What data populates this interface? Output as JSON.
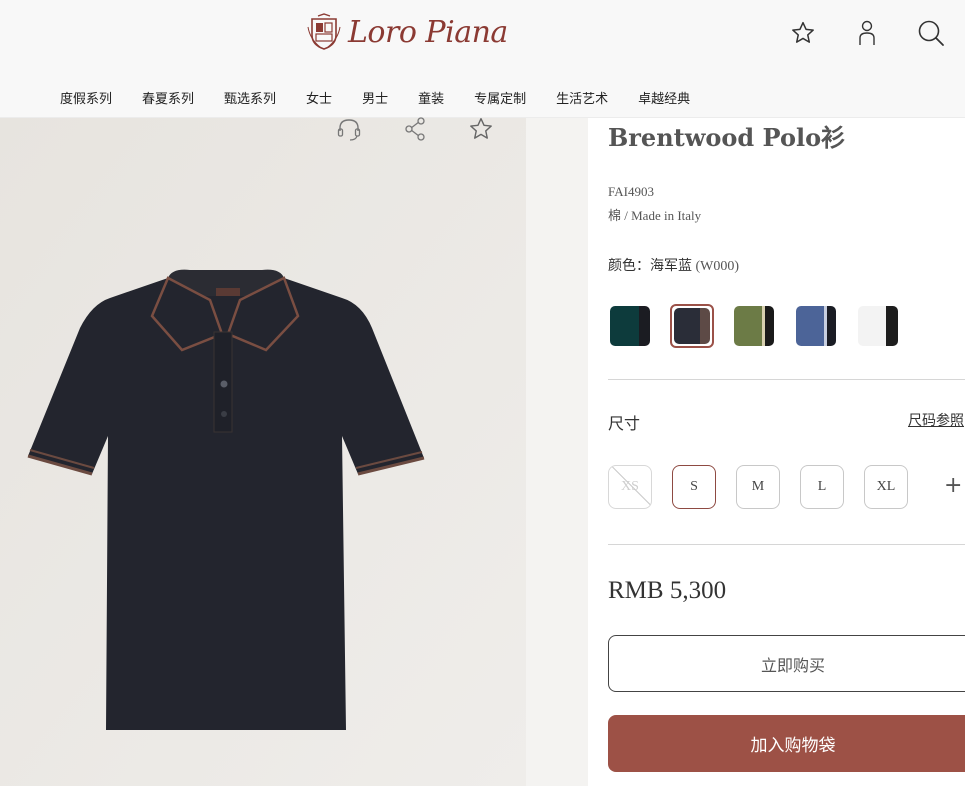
{
  "header": {
    "logo_text": "Loro Piana",
    "icons": [
      "star-icon",
      "account-icon",
      "search-icon"
    ],
    "nav": [
      {
        "label": "度假系列"
      },
      {
        "label": "春夏系列"
      },
      {
        "label": "甄选系列"
      },
      {
        "label": "女士"
      },
      {
        "label": "男士"
      },
      {
        "label": "童装"
      },
      {
        "label": "专属定制"
      },
      {
        "label": "生活艺术"
      },
      {
        "label": "卓越经典"
      }
    ]
  },
  "image_tools": [
    "headset-icon",
    "share-icon",
    "star-icon"
  ],
  "product": {
    "title": "Brentwood Polo衫",
    "sku": "FAI4903",
    "material": "棉 / Made in Italy",
    "color_label": "颜色：海军蓝",
    "color_code": " (W000)",
    "swatches": [
      {
        "name": "dark-green",
        "left": "#0b3a3a",
        "right": "#1b1c20",
        "selected": false
      },
      {
        "name": "navy",
        "left": "#2a2d38",
        "right": "#5a4744",
        "selected": true
      },
      {
        "name": "olive",
        "left": "#6b7a44",
        "right": "#1a1a1a",
        "selected": false
      },
      {
        "name": "blue",
        "left": "#4a6296",
        "right": "#1a1c24",
        "selected": false
      },
      {
        "name": "white",
        "left": "#f4f4f4",
        "right": "#1d1d1d",
        "selected": false
      }
    ],
    "size_label": "尺寸",
    "size_guide": "尺码参照",
    "sizes": [
      {
        "label": "XS",
        "state": "disabled"
      },
      {
        "label": "S",
        "state": "selected"
      },
      {
        "label": "M",
        "state": "available"
      },
      {
        "label": "L",
        "state": "available"
      },
      {
        "label": "XL",
        "state": "available"
      }
    ],
    "more_sizes": "+",
    "price": "RMB 5,300",
    "buy_now": "立即购买",
    "add_to_bag": "加入购物袋"
  },
  "colors": {
    "accent": "#9d5146",
    "brand": "#8b3a33"
  }
}
